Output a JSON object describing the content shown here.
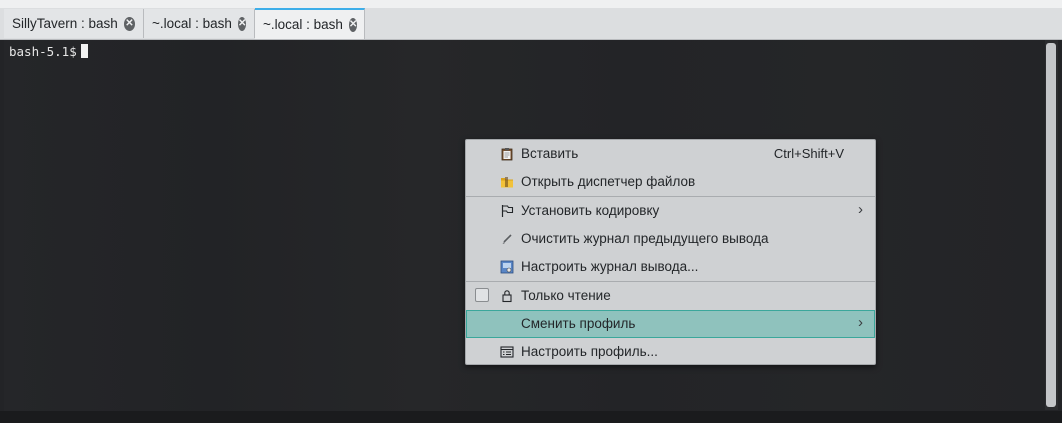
{
  "tabs": [
    {
      "label": "SillyTavern : bash"
    },
    {
      "label": "~.local : bash"
    },
    {
      "label": "~.local : bash"
    }
  ],
  "terminal": {
    "prompt": "bash-5.1$"
  },
  "menu": {
    "paste": {
      "label": "Вставить",
      "shortcut": "Ctrl+Shift+V",
      "icon": "clipboard-icon"
    },
    "open_fm": {
      "label": "Открыть диспетчер файлов",
      "icon": "folder-icon"
    },
    "encoding": {
      "label": "Установить кодировку",
      "icon": "flag-icon"
    },
    "clear_history": {
      "label": "Очистить журнал предыдущего вывода",
      "icon": "brush-icon"
    },
    "config_history": {
      "label": "Настроить журнал вывода...",
      "icon": "settings-image-icon"
    },
    "readonly": {
      "label": "Только чтение",
      "icon": "lock-icon",
      "checked": false
    },
    "switch_profile": {
      "label": "Сменить профиль"
    },
    "config_profile": {
      "label": "Настроить профиль...",
      "icon": "profile-list-icon"
    }
  },
  "colors": {
    "highlight": "#8fc2bd",
    "active_tab_accent": "#3daee9",
    "terminal_bg": "#232427"
  }
}
